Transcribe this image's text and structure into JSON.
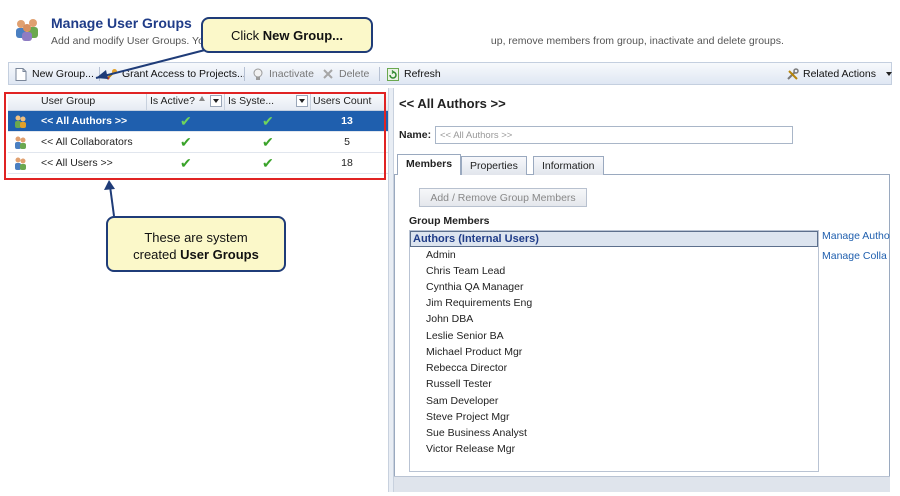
{
  "header": {
    "title": "Manage User Groups",
    "subtitle_left": "Add and modify User Groups. Yo",
    "subtitle_right": "up, remove members from group, inactivate and delete groups.",
    "icon": "users-group-icon"
  },
  "toolbar": {
    "new_group": "New Group...",
    "grant_access": "Grant Access to Projects...",
    "inactivate": "Inactivate",
    "delete": "Delete",
    "refresh": "Refresh",
    "related_actions": "Related Actions"
  },
  "grid": {
    "columns": [
      "User Group",
      "Is Active?",
      "Is Syste...",
      "Users Count"
    ],
    "rows": [
      {
        "name": "<< All Authors >>",
        "active": "✔",
        "system": "✔",
        "count": "13",
        "selected": true
      },
      {
        "name": "<< All Collaborators",
        "active": "✔",
        "system": "✔",
        "count": "5",
        "selected": false
      },
      {
        "name": "<< All Users >>",
        "active": "✔",
        "system": "✔",
        "count": "18",
        "selected": false
      }
    ]
  },
  "callouts": {
    "new_group_text": "Click ",
    "new_group_bold": "New Group...",
    "system_line1": "These are system",
    "system_line2": "created ",
    "system_bold": "User Groups"
  },
  "detail": {
    "title": "<< All Authors >>",
    "name_label": "Name:",
    "name_value": "<< All Authors >>",
    "tabs": [
      "Members",
      "Properties",
      "Information"
    ],
    "active_tab": "Members",
    "add_remove_button": "Add / Remove Group Members",
    "group_members_label": "Group Members",
    "members_header": "Authors (Internal Users)",
    "members": [
      "Admin",
      "Chris Team Lead",
      "Cynthia QA Manager",
      "Jim Requirements Eng",
      "John DBA",
      "Leslie Senior BA",
      "Michael Product Mgr",
      "Rebecca Director",
      "Russell Tester",
      "Sam Developer",
      "Steve Project Mgr",
      "Sue Business Analyst",
      "Victor Release Mgr"
    ],
    "links": [
      "Manage Autho",
      "Manage Colla"
    ]
  },
  "colors": {
    "accent": "#1f5fae",
    "title": "#1f3c88",
    "callout_bg": "#fbf8c9",
    "highlight_border": "#e02323",
    "check": "#3aa32a"
  }
}
